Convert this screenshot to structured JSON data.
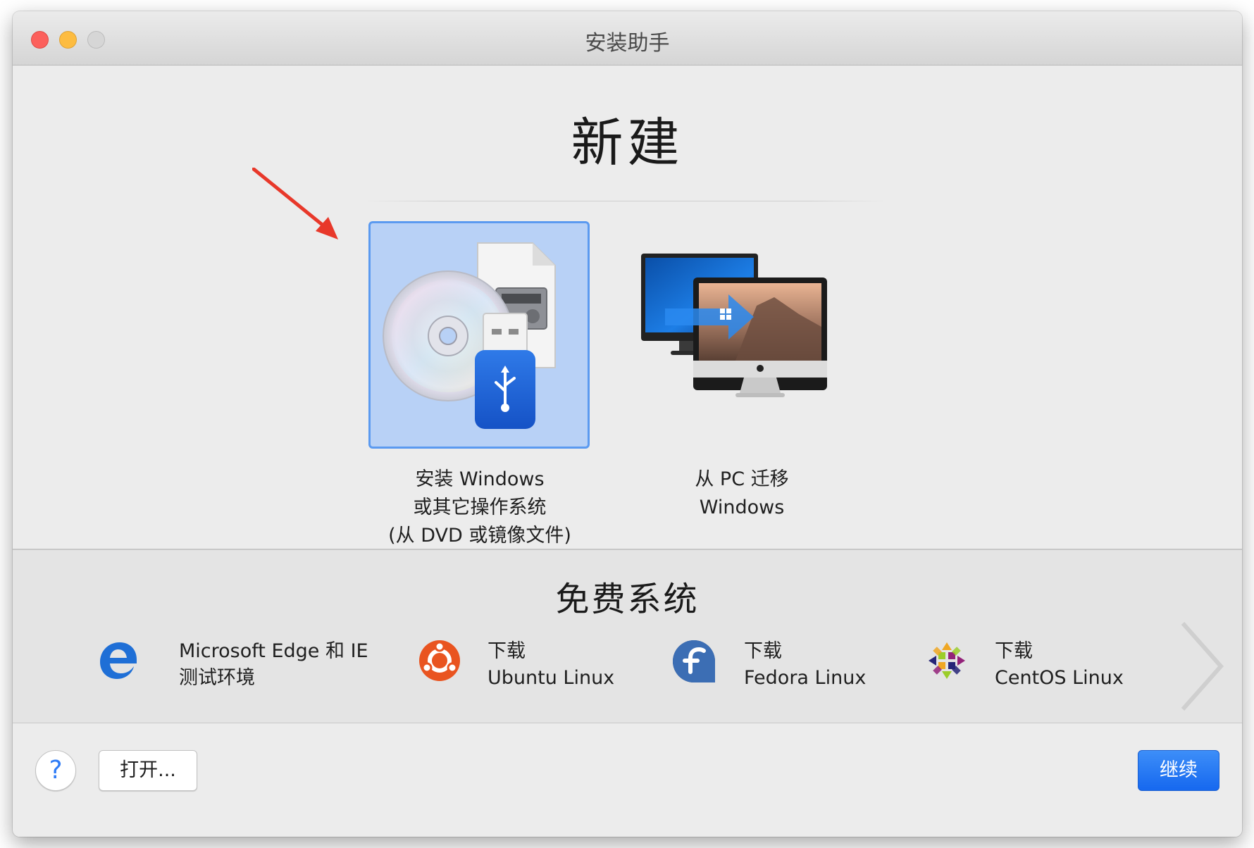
{
  "window": {
    "title": "安装助手"
  },
  "main": {
    "heading": "新建",
    "options": [
      {
        "lines": [
          "安装 Windows",
          "或其它操作系统",
          "(从 DVD 或镜像文件)"
        ],
        "selected": true,
        "icon": "install-media-icon"
      },
      {
        "lines": [
          "从 PC 迁移",
          "Windows"
        ],
        "selected": false,
        "icon": "migrate-pc-icon"
      }
    ]
  },
  "free_systems": {
    "heading": "免费系统",
    "items": [
      {
        "line1": "Microsoft Edge 和 IE",
        "line2": "测试环境",
        "icon": "edge-icon"
      },
      {
        "line1": "下载",
        "line2": "Ubuntu Linux",
        "icon": "ubuntu-icon"
      },
      {
        "line1": "下载",
        "line2": "Fedora Linux",
        "icon": "fedora-icon"
      },
      {
        "line1": "下载",
        "line2": "CentOS Linux",
        "icon": "centos-icon"
      }
    ]
  },
  "footer": {
    "help_label": "?",
    "open_label": "打开...",
    "continue_label": "继续"
  },
  "colors": {
    "accent": "#1a6cf0",
    "selection_fill": "#b8d1f6",
    "selection_border": "#5b9af0",
    "annotation_arrow": "#e8382a"
  }
}
